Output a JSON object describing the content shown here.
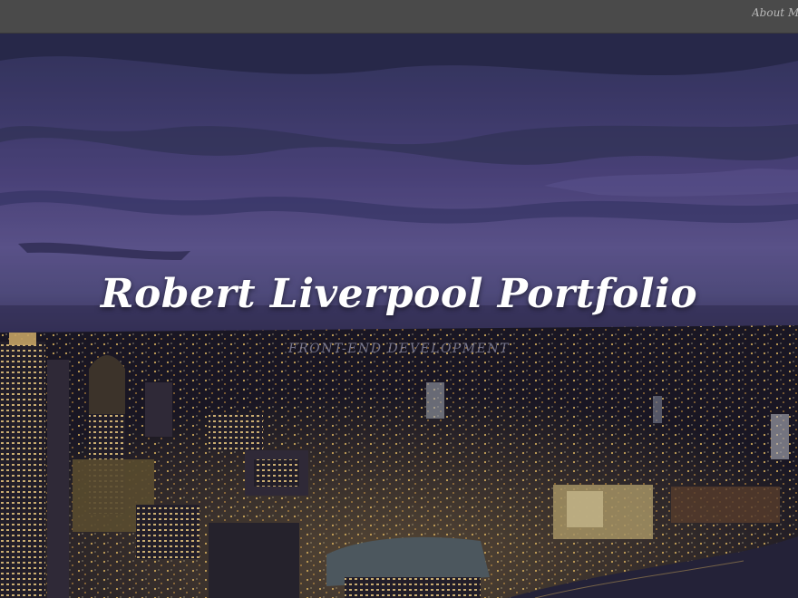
{
  "nav": {
    "about_label": "About Me"
  },
  "hero": {
    "title": "Robert Liverpool Portfolio",
    "subtitle": "FRONT-END DEVELOPMENT"
  },
  "colors": {
    "topbar": "#4a4a4a",
    "sky": "#5a5093",
    "city_light": "#f2c56a",
    "title": "#ffffff"
  }
}
